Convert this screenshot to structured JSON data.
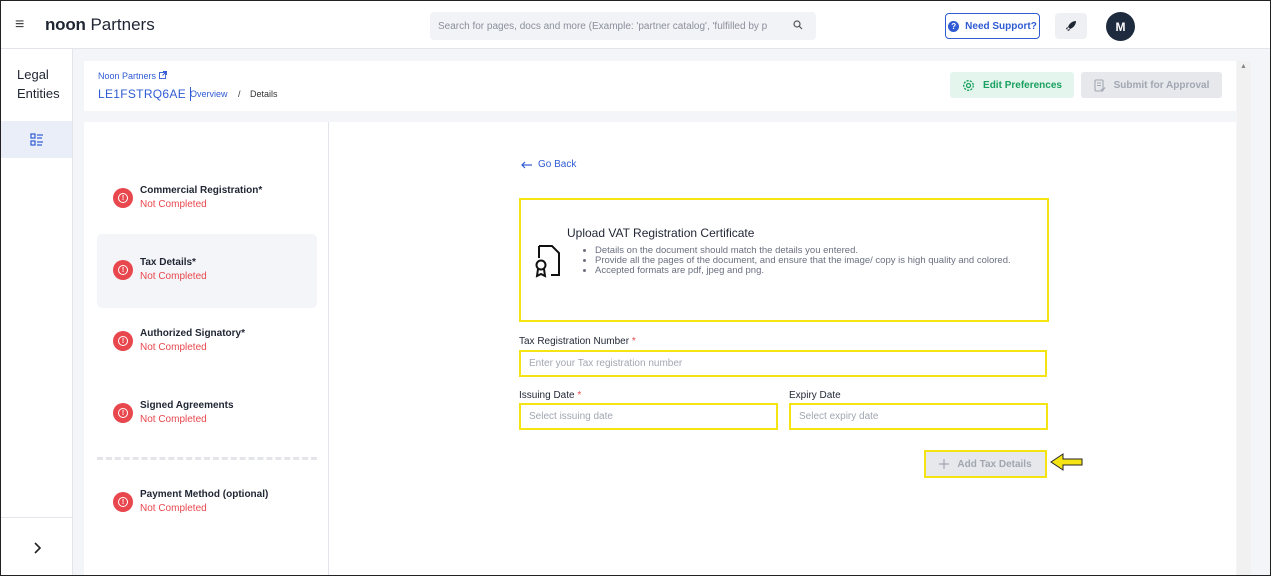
{
  "header": {
    "brand_bold": "noon",
    "brand_rest": " Partners",
    "search_placeholder": "Search for pages, docs and more (Example: 'partner catalog', 'fulfilled by p",
    "support_label": "Need Support?",
    "avatar_initial": "M"
  },
  "sidebar": {
    "title_line1": "Legal",
    "title_line2": "Entities"
  },
  "breadcrumb": {
    "root": "Noon Partners",
    "entity_id": "LE1FSTRQ6AE",
    "overview": "Overview",
    "separator": "/",
    "current": "Details"
  },
  "actions": {
    "edit_preferences": "Edit Preferences",
    "submit_for_approval": "Submit for Approval"
  },
  "steps": [
    {
      "name": "Commercial Registration*",
      "status": "Not Completed"
    },
    {
      "name": "Tax Details*",
      "status": "Not Completed"
    },
    {
      "name": "Authorized Signatory*",
      "status": "Not Completed"
    },
    {
      "name": "Signed Agreements",
      "status": "Not Completed"
    },
    {
      "name": "Payment Method (optional)",
      "status": "Not Completed"
    }
  ],
  "form": {
    "go_back": "Go Back",
    "upload_title": "Upload VAT Registration Certificate",
    "upload_notes": [
      "Details on the document should match the details you entered.",
      "Provide all the pages of the document, and ensure that the image/ copy is high quality and colored.",
      "Accepted formats are pdf, jpeg and png."
    ],
    "trn_label": "Tax Registration Number ",
    "trn_placeholder": "Enter your Tax registration number",
    "required_mark": "*",
    "issuing_label": "Issuing Date ",
    "issuing_placeholder": "Select issuing date",
    "expiry_label": "Expiry Date",
    "expiry_placeholder": "Select expiry date",
    "add_button": "Add Tax Details"
  },
  "colors": {
    "accent": "#2f5bd3",
    "error": "#e8474d",
    "success": "#1aa060",
    "highlight": "#f5e414"
  }
}
